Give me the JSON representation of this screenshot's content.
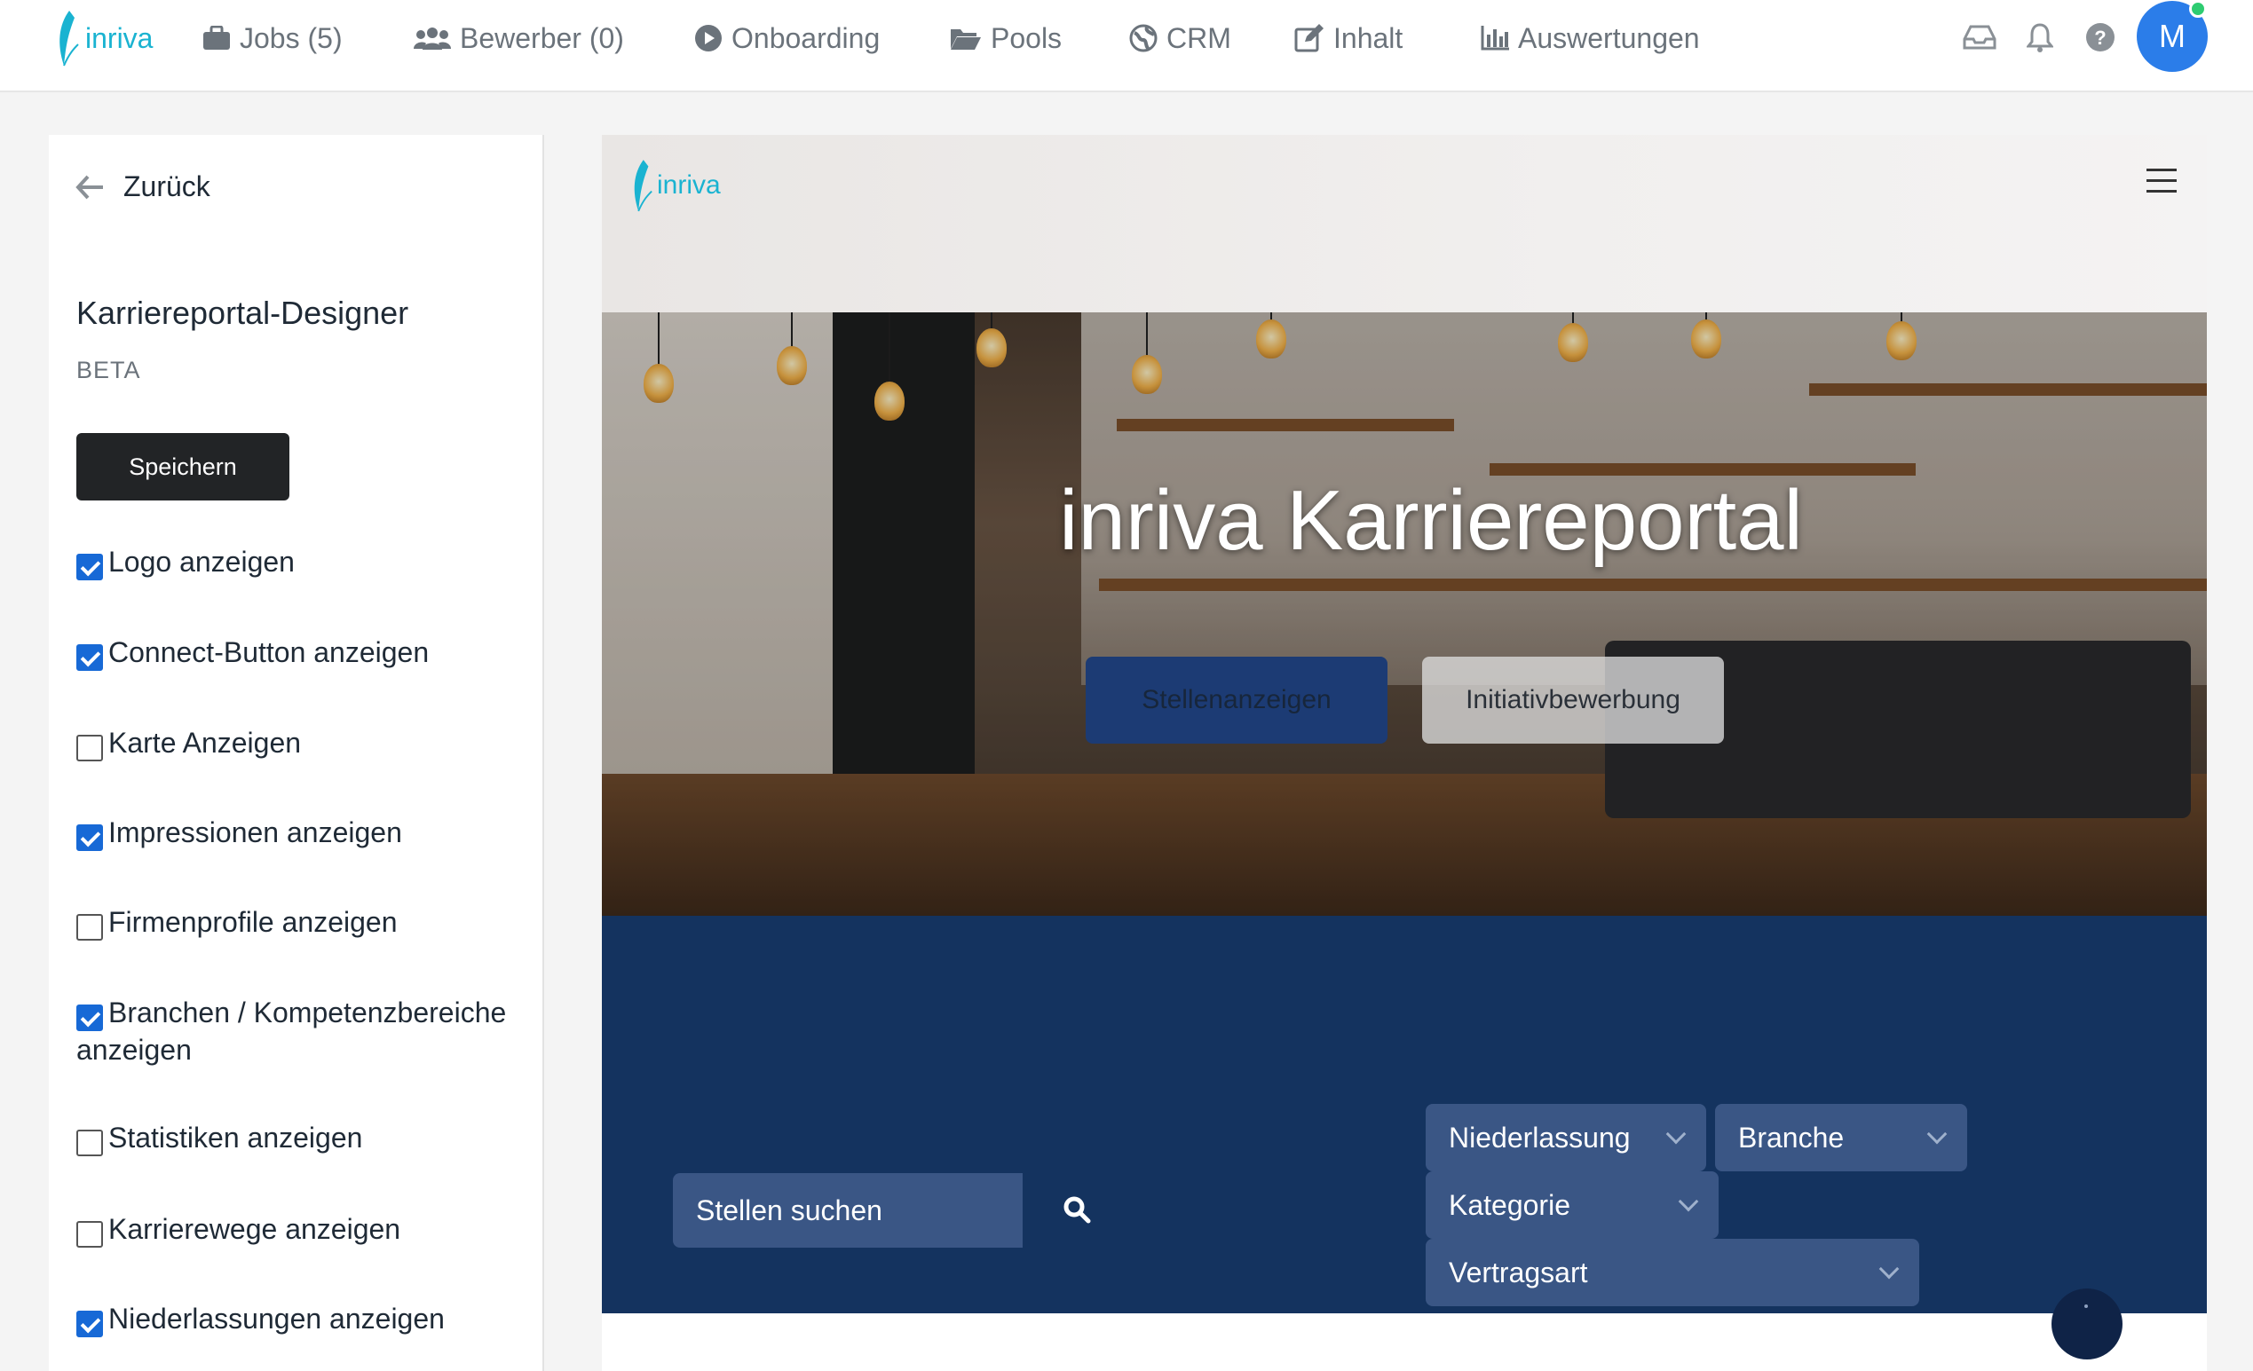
{
  "topnav": {
    "brand": "inriva",
    "items": [
      {
        "label": "Jobs (5)",
        "icon": "briefcase-icon"
      },
      {
        "label": "Bewerber (0)",
        "icon": "users-icon"
      },
      {
        "label": "Onboarding",
        "icon": "play-circle-icon"
      },
      {
        "label": "Pools",
        "icon": "folder-open-icon"
      },
      {
        "label": "CRM",
        "icon": "globe-icon"
      },
      {
        "label": "Inhalt",
        "icon": "edit-icon"
      },
      {
        "label": "Auswertungen",
        "icon": "bar-chart-icon"
      }
    ],
    "right_icons": [
      "inbox-icon",
      "bell-icon",
      "help-icon"
    ],
    "avatar_initial": "M",
    "online_color": "#2ecc71"
  },
  "sidebar": {
    "back_label": "Zurück",
    "title": "Karriereportal-Designer",
    "badge": "BETA",
    "save_label": "Speichern",
    "options": [
      {
        "label": "Logo anzeigen",
        "checked": true
      },
      {
        "label": "Connect-Button anzeigen",
        "checked": true
      },
      {
        "label": "Karte Anzeigen",
        "checked": false
      },
      {
        "label": "Impressionen anzeigen",
        "checked": true
      },
      {
        "label": "Firmenprofile anzeigen",
        "checked": false
      },
      {
        "label": "Branchen / Kompetenzbereiche anzeigen",
        "checked": true
      },
      {
        "label": "Statistiken anzeigen",
        "checked": false
      },
      {
        "label": "Karrierewege anzeigen",
        "checked": false
      },
      {
        "label": "Niederlassungen anzeigen",
        "checked": true
      }
    ]
  },
  "preview": {
    "logo_text": "inriva",
    "hero_title": "inriva Karriereportal",
    "btn_jobs": "Stellenanzeigen",
    "btn_initiative": "Initiativbewerbung",
    "search_placeholder": "Stellen suchen",
    "filters": {
      "location": "Niederlassung",
      "industry": "Branche",
      "category": "Kategorie",
      "contract": "Vertragsart"
    }
  },
  "colors": {
    "accent": "#1769d6",
    "brand": "#1ab3d1",
    "band": "#14335f",
    "filter_bg": "#3a5685"
  }
}
